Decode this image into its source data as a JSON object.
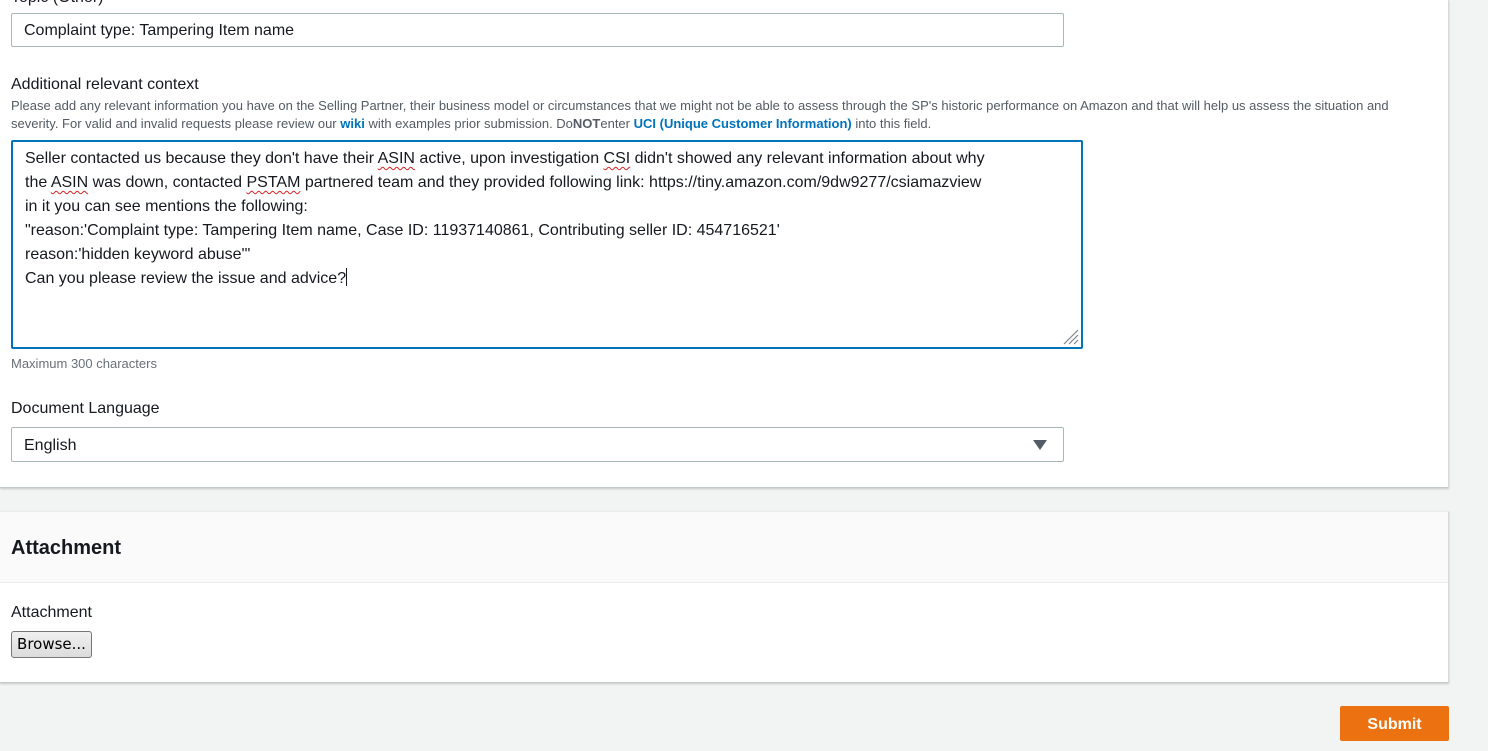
{
  "topic_field": {
    "label": "Topic (Other)",
    "value": "Complaint type: Tampering Item name"
  },
  "context_field": {
    "label": "Additional relevant context",
    "description": {
      "part1": "Please add any relevant information you have on the Selling Partner, their business model or circumstances that we might not be able to assess through the SP's historic performance on Amazon and that will help us assess the situation and severity. For valid and invalid requests please review our ",
      "link_wiki": "wiki",
      "part2": " with examples prior submission. Do",
      "not_word": "NOT",
      "part3": "enter ",
      "link_uci": "UCI (Unique Customer Information)",
      "part4": " into this field."
    },
    "value_lines": [
      {
        "pre": "Seller contacted us because they don't have their ",
        "sq1": "ASIN",
        "mid": " active, upon investigation ",
        "sq2": "CSI",
        "post": " didn't showed any relevant information about why"
      },
      {
        "pre": "the ",
        "sq1": "ASIN",
        "mid": " was down, contacted ",
        "sq2": "PSTAM",
        "post": " partnered team and they provided following link: https://tiny.amazon.com/9dw9277/csiamazview"
      },
      {
        "text": "in it you can see mentions the following:"
      },
      {
        "text": "\"reason:'Complaint type: Tampering Item name, Case ID: 11937140861, Contributing seller ID: 454716521'"
      },
      {
        "text": "reason:'hidden keyword abuse'\""
      },
      {
        "text": "Can you please review the issue and advice?"
      }
    ],
    "hint": "Maximum 300 characters"
  },
  "language_field": {
    "label": "Document Language",
    "selected": "English"
  },
  "attachment_section": {
    "title": "Attachment",
    "label": "Attachment",
    "browse_label": "Browse..."
  },
  "actions": {
    "submit_label": "Submit"
  },
  "colors": {
    "accent_orange": "#ec7211",
    "link_blue": "#0073bb",
    "focus_border": "#0073bb",
    "page_background": "#f2f3f3"
  }
}
